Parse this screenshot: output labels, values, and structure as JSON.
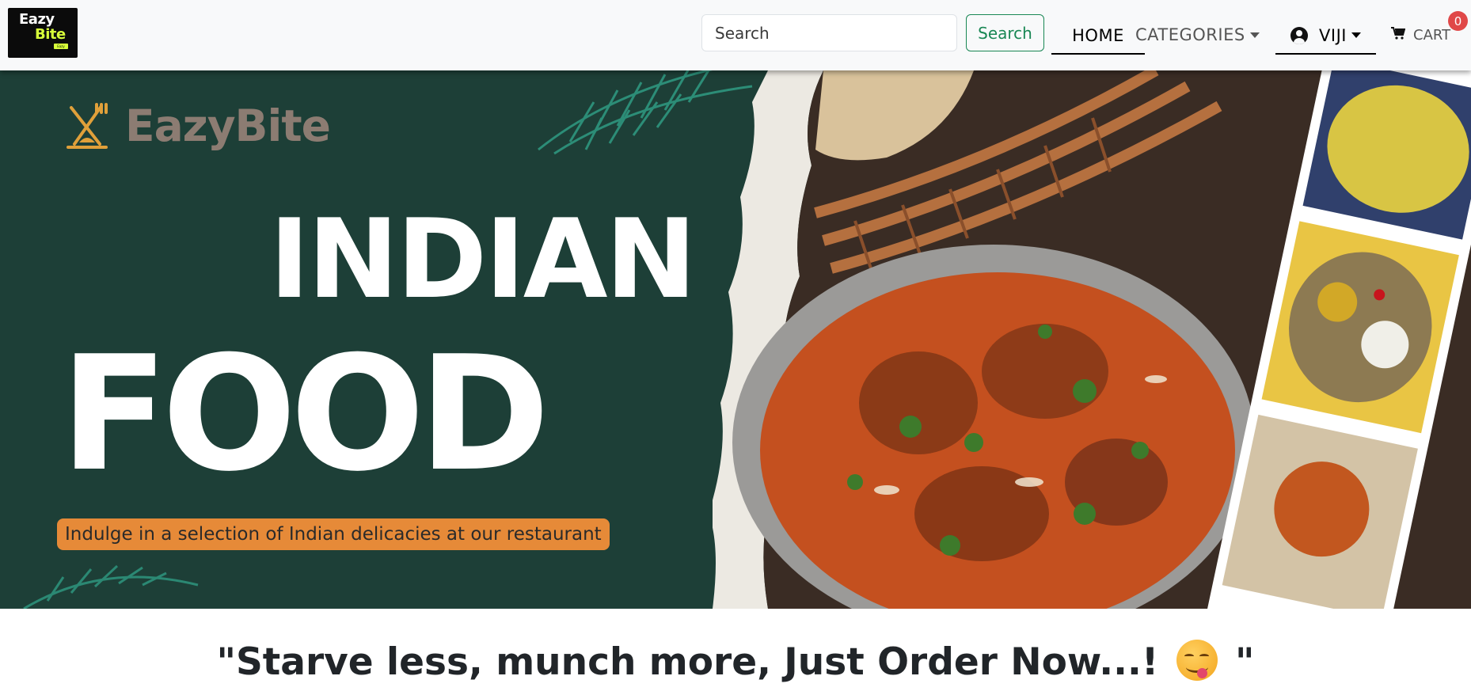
{
  "navbar": {
    "logo": {
      "line1": "Eazy",
      "line2": "Bite",
      "line3": "Eazy"
    },
    "search": {
      "placeholder": "Search",
      "button": "Search"
    },
    "links": {
      "home": "HOME",
      "categories": "CATEGORIES",
      "user": "VIJI",
      "cart": "CART"
    },
    "cart_count": "0"
  },
  "hero": {
    "brand": "EazyBite",
    "title_line1": "INDIAN",
    "title_line2": "FOOD",
    "tagline": "Indulge in a selection of Indian delicacies at our restaurant"
  },
  "quote": {
    "text_start": "\"Starve less, munch more, Just Order Now...! ",
    "text_end": " \""
  },
  "colors": {
    "hero_bg": "#1d3f37",
    "tagline_bg": "#e68a38",
    "search_green": "#198754",
    "badge_red": "#e04848",
    "brand_text": "#8c7c72"
  }
}
